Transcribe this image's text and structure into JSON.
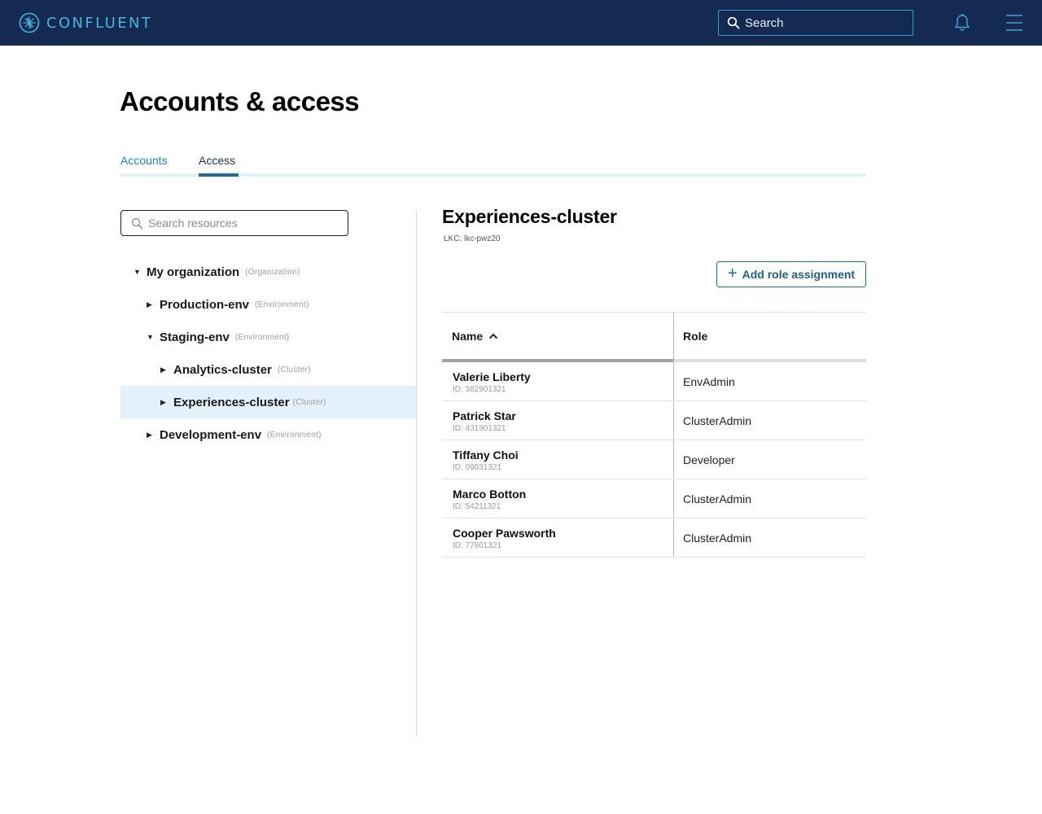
{
  "app": {
    "brand": "CONFLUENT",
    "search_placeholder": "Search"
  },
  "page": {
    "title": "Accounts & access",
    "tabs": [
      {
        "label": "Accounts",
        "active": false
      },
      {
        "label": "Access",
        "active": true
      }
    ]
  },
  "resources": {
    "search_placeholder": "Search resources",
    "tree": [
      {
        "label": "My organization",
        "type": "(Organization)",
        "expanded": true,
        "selected": false
      },
      {
        "label": "Production-env",
        "type": "(Environment)",
        "expanded": false,
        "selected": false
      },
      {
        "label": "Staging-env",
        "type": "(Environment)",
        "expanded": true,
        "selected": false
      },
      {
        "label": "Analytics-cluster",
        "type": "(Cluster)",
        "expanded": false,
        "selected": false
      },
      {
        "label": "Experiences-cluster",
        "type": "(Cluster)",
        "expanded": false,
        "selected": true
      },
      {
        "label": "Development-env",
        "type": "(Environment)",
        "expanded": false,
        "selected": false
      }
    ]
  },
  "detail": {
    "title": "Experiences-cluster",
    "id_label": "LKC: lkc-pwz20",
    "add_button_label": "Add role assignment",
    "table": {
      "columns": [
        "Name",
        "Role"
      ],
      "sort": "Name ascending",
      "rows": [
        {
          "name": "Valerie Liberty",
          "id": "ID: 382901321",
          "role": "EnvAdmin"
        },
        {
          "name": "Patrick Star",
          "id": "ID: 431901321",
          "role": "ClusterAdmin"
        },
        {
          "name": "Tiffany Choi",
          "id": "ID: 09831321",
          "role": "Developer"
        },
        {
          "name": "Marco Botton",
          "id": "ID: 54211321",
          "role": "ClusterAdmin"
        },
        {
          "name": "Cooper Pawsworth",
          "id": "ID: 77801321",
          "role": "ClusterAdmin"
        }
      ]
    }
  },
  "colors": {
    "topbar": "#152a50",
    "brand_accent": "#46b5de",
    "tab_active": "#1b6d95",
    "selected_row": "#e3f2fa",
    "button_border": "#1e6e96"
  },
  "icons": [
    "confluent-logo-icon",
    "search-icon",
    "bell-icon",
    "hamburger-menu-icon",
    "caret-down-icon",
    "caret-right-icon",
    "plus-icon",
    "sort-ascending-icon"
  ]
}
